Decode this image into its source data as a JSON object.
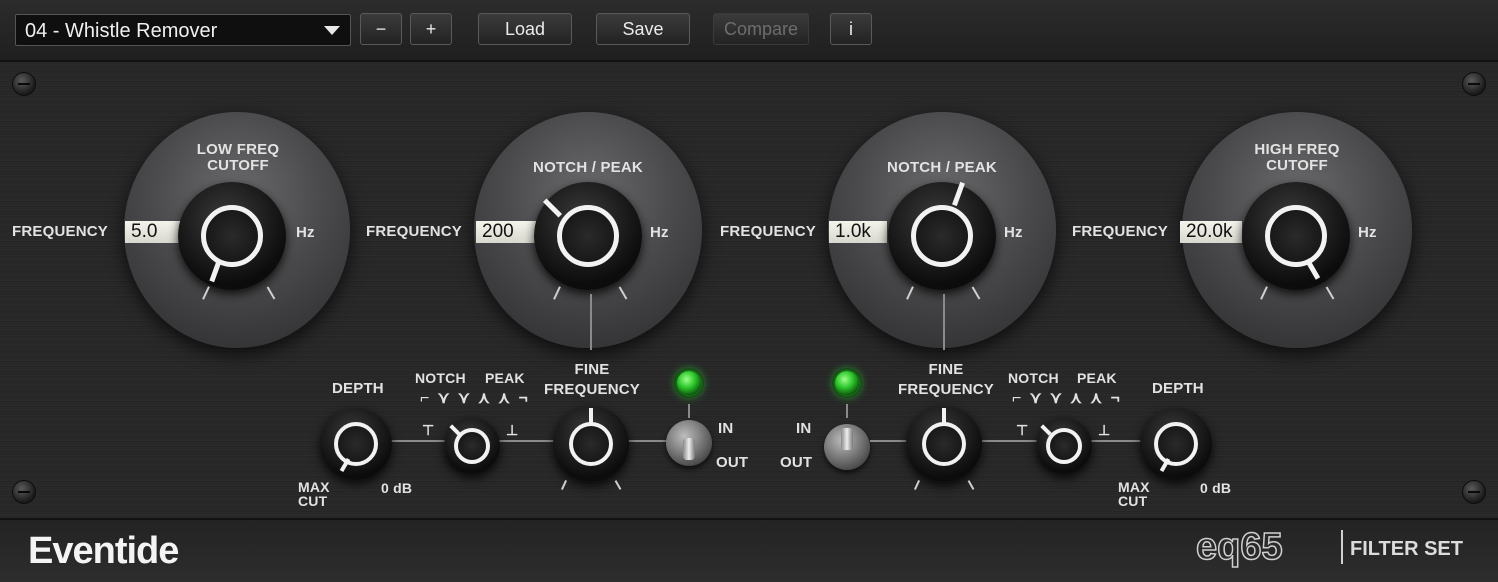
{
  "toolbar": {
    "preset_name": "04 - Whistle Remover",
    "minus_label": "−",
    "plus_label": "+",
    "load_label": "Load",
    "save_label": "Save",
    "compare_label": "Compare",
    "info_label": "i"
  },
  "low_cut": {
    "title": "LOW FREQ\nCUTOFF",
    "param_label": "FREQUENCY",
    "value": "5.0",
    "unit": "Hz"
  },
  "notch1": {
    "title": "NOTCH / PEAK",
    "param_label": "FREQUENCY",
    "value": "200",
    "unit": "Hz",
    "fine_label": "FINE\nFREQUENCY",
    "mode_notch": "NOTCH",
    "mode_peak": "PEAK",
    "depth_label": "DEPTH",
    "max_cut": "MAX\nCUT",
    "zero_db": "0 dB",
    "in_label": "IN",
    "out_label": "OUT",
    "shape_glyphs": "⌐ ⋎ ⋎  ⋏ ⋏ ¬",
    "floor_glyph": "⊤",
    "ceil_glyph": "⊥"
  },
  "notch2": {
    "title": "NOTCH / PEAK",
    "param_label": "FREQUENCY",
    "value": "1.0k",
    "unit": "Hz",
    "fine_label": "FINE\nFREQUENCY",
    "mode_notch": "NOTCH",
    "mode_peak": "PEAK",
    "depth_label": "DEPTH",
    "max_cut": "MAX\nCUT",
    "zero_db": "0 dB",
    "in_label": "IN",
    "out_label": "OUT",
    "shape_glyphs": "⌐ ⋎ ⋎  ⋏ ⋏ ¬",
    "floor_glyph": "⊤",
    "ceil_glyph": "⊥"
  },
  "high_cut": {
    "title": "HIGH FREQ\nCUTOFF",
    "param_label": "FREQUENCY",
    "value": "20.0k",
    "unit": "Hz"
  },
  "footer": {
    "brand": "Eventide",
    "product": "eq65",
    "suffix": "FILTER SET"
  }
}
